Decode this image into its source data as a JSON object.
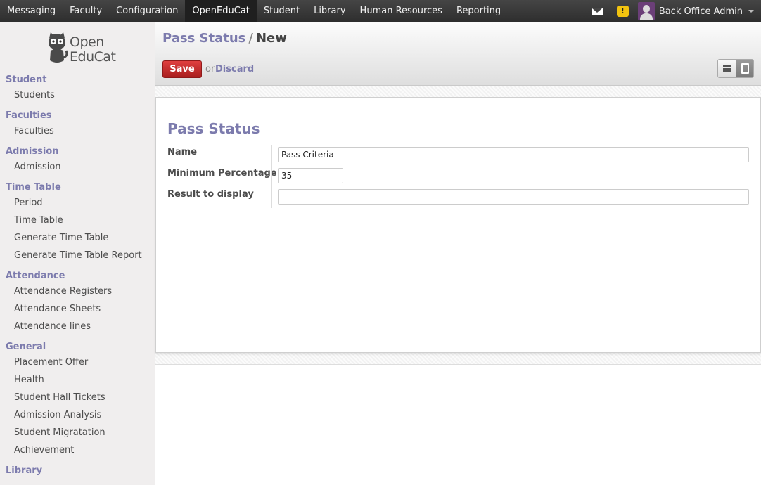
{
  "topbar": {
    "menu": [
      "Messaging",
      "Faculty",
      "Configuration",
      "OpenEduCat",
      "Student",
      "Library",
      "Human Resources",
      "Reporting"
    ],
    "active_menu": "OpenEduCat",
    "user_name": "Back Office Admin",
    "icons": [
      "mail-icon",
      "warning-icon",
      "avatar"
    ]
  },
  "logo": {
    "line1": "Open",
    "line2": "EduCat"
  },
  "sidebar": {
    "sections": [
      {
        "title": "Student",
        "items": [
          "Students"
        ]
      },
      {
        "title": "Faculties",
        "items": [
          "Faculties"
        ]
      },
      {
        "title": "Admission",
        "items": [
          "Admission"
        ]
      },
      {
        "title": "Time Table",
        "items": [
          "Period",
          "Time Table",
          "Generate Time Table",
          "Generate Time Table Report"
        ]
      },
      {
        "title": "Attendance",
        "items": [
          "Attendance Registers",
          "Attendance Sheets",
          "Attendance lines"
        ]
      },
      {
        "title": "General",
        "items": [
          "Placement Offer",
          "Health",
          "Student Hall Tickets",
          "Admission Analysis",
          "Student Migratation",
          "Achievement"
        ]
      },
      {
        "title": "Library",
        "items": []
      }
    ]
  },
  "breadcrumb": {
    "parent": "Pass Status",
    "separator": "/",
    "current": "New"
  },
  "actions": {
    "save": "Save",
    "or": "or",
    "discard": "Discard"
  },
  "form": {
    "title": "Pass Status",
    "fields": [
      {
        "label": "Name",
        "value": "Pass Criteria"
      },
      {
        "label": "Minimum Percentage",
        "value": "35"
      },
      {
        "label": "Result to display",
        "value": ""
      }
    ]
  },
  "colors": {
    "accent": "#7c7bad",
    "save": "#c02a2a",
    "topbar": "#3a3a3a"
  }
}
